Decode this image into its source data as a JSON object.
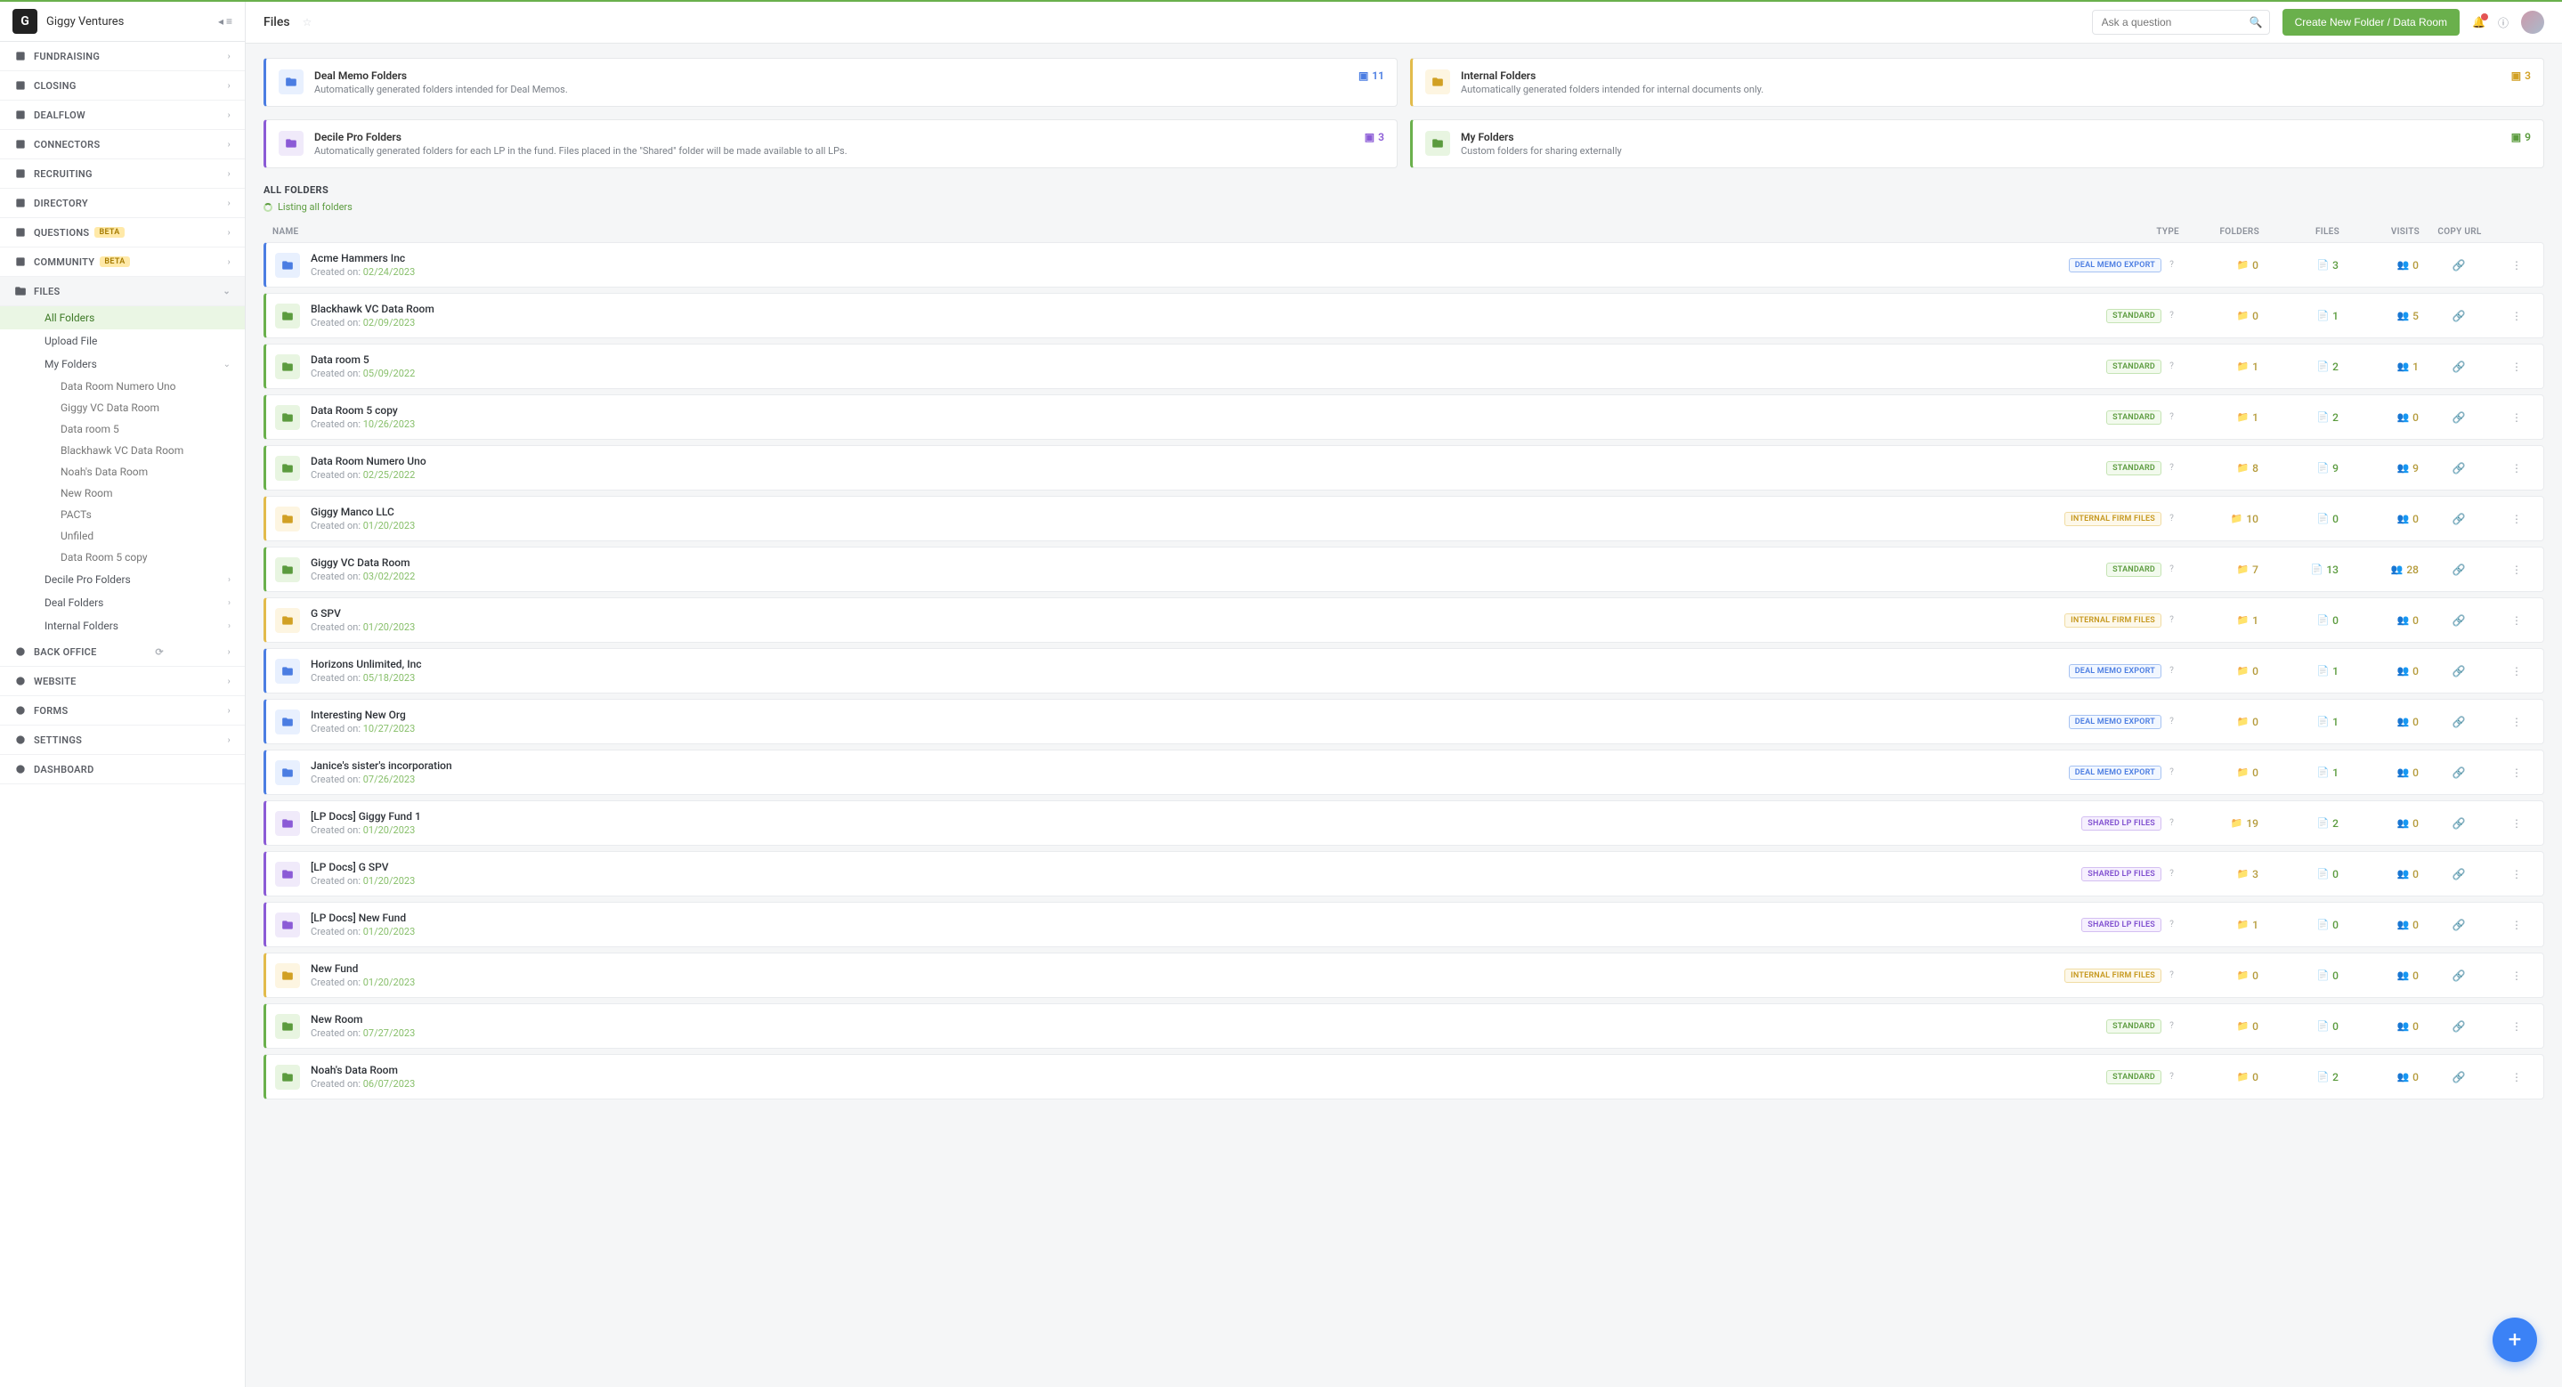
{
  "header": {
    "org_name": "Giggy Ventures",
    "page_title": "Files",
    "create_label": "Create New Folder / Data Room",
    "search_placeholder": "Ask a question"
  },
  "sidebar": {
    "items": [
      {
        "label": "FUNDRAISING",
        "icon": "chart"
      },
      {
        "label": "CLOSING",
        "icon": "check"
      },
      {
        "label": "DEALFLOW",
        "icon": "flow"
      },
      {
        "label": "CONNECTORS",
        "icon": "link"
      },
      {
        "label": "RECRUITING",
        "icon": "users"
      },
      {
        "label": "DIRECTORY",
        "icon": "book"
      },
      {
        "label": "QUESTIONS",
        "icon": "q",
        "badge": "BETA"
      },
      {
        "label": "COMMUNITY",
        "icon": "people",
        "badge": "BETA"
      }
    ],
    "files_label": "FILES",
    "files_children": [
      {
        "label": "All Folders",
        "active": true
      },
      {
        "label": "Upload File"
      },
      {
        "label": "My Folders",
        "expand": true,
        "children": [
          {
            "label": "Data Room Numero Uno"
          },
          {
            "label": "Giggy VC Data Room"
          },
          {
            "label": "Data room 5"
          },
          {
            "label": "Blackhawk VC Data Room"
          },
          {
            "label": "Noah's Data Room"
          },
          {
            "label": "New Room"
          },
          {
            "label": "PACTs"
          },
          {
            "label": "Unfiled"
          },
          {
            "label": "Data Room 5 copy"
          }
        ]
      },
      {
        "label": "Decile Pro Folders",
        "chev": true
      },
      {
        "label": "Deal Folders",
        "chev": true
      },
      {
        "label": "Internal Folders",
        "chev": true
      }
    ],
    "bottom": [
      {
        "label": "BACK OFFICE",
        "sync": true
      },
      {
        "label": "WEBSITE"
      },
      {
        "label": "FORMS"
      },
      {
        "label": "SETTINGS"
      },
      {
        "label": "DASHBOARD",
        "nochev": true
      }
    ]
  },
  "cards": [
    {
      "cls": "blue",
      "title": "Deal Memo Folders",
      "sub": "Automatically generated folders intended for Deal Memos.",
      "count": 11
    },
    {
      "cls": "yellow",
      "title": "Internal Folders",
      "sub": "Automatically generated folders intended for internal documents only.",
      "count": 3
    },
    {
      "cls": "purple",
      "title": "Decile Pro Folders",
      "sub": "Automatically generated folders for each LP in the fund. Files placed in the \"Shared\" folder will be made available to all LPs.",
      "count": 3
    },
    {
      "cls": "green",
      "title": "My Folders",
      "sub": "Custom folders for sharing externally",
      "count": 9
    }
  ],
  "section": {
    "title": "ALL FOLDERS",
    "listing": "Listing all folders"
  },
  "columns": {
    "name": "NAME",
    "type": "TYPE",
    "folders": "FOLDERS",
    "files": "FILES",
    "visits": "VISITS",
    "copy": "COPY URL"
  },
  "created_prefix": "Created on:",
  "type_labels": {
    "dme": "DEAL MEMO EXPORT",
    "std": "STANDARD",
    "int": "INTERNAL FIRM FILES",
    "shlp": "SHARED LP FILES"
  },
  "rows": [
    {
      "cls": "blue",
      "name": "Acme Hammers Inc",
      "date": "02/24/2023",
      "type": "dme",
      "folders": 0,
      "files": 3,
      "visits": 0
    },
    {
      "cls": "green",
      "name": "Blackhawk VC Data Room",
      "date": "02/09/2023",
      "type": "std",
      "folders": 0,
      "files": 1,
      "visits": 5
    },
    {
      "cls": "green",
      "name": "Data room 5",
      "date": "05/09/2022",
      "type": "std",
      "folders": 1,
      "files": 2,
      "visits": 1
    },
    {
      "cls": "green",
      "name": "Data Room 5 copy",
      "date": "10/26/2023",
      "type": "std",
      "folders": 1,
      "files": 2,
      "visits": 0
    },
    {
      "cls": "green",
      "name": "Data Room Numero Uno",
      "date": "02/25/2022",
      "type": "std",
      "folders": 8,
      "files": 9,
      "visits": 9
    },
    {
      "cls": "yellow",
      "name": "Giggy Manco LLC",
      "date": "01/20/2023",
      "type": "int",
      "folders": 10,
      "files": 0,
      "visits": 0
    },
    {
      "cls": "green",
      "name": "Giggy VC Data Room",
      "date": "03/02/2022",
      "type": "std",
      "folders": 7,
      "files": 13,
      "visits": 28
    },
    {
      "cls": "yellow",
      "name": "G SPV",
      "date": "01/20/2023",
      "type": "int",
      "folders": 1,
      "files": 0,
      "visits": 0
    },
    {
      "cls": "blue",
      "name": "Horizons Unlimited, Inc",
      "date": "05/18/2023",
      "type": "dme",
      "folders": 0,
      "files": 1,
      "visits": 0
    },
    {
      "cls": "blue",
      "name": "Interesting New Org",
      "date": "10/27/2023",
      "type": "dme",
      "folders": 0,
      "files": 1,
      "visits": 0
    },
    {
      "cls": "blue",
      "name": "Janice's sister's incorporation",
      "date": "07/26/2023",
      "type": "dme",
      "folders": 0,
      "files": 1,
      "visits": 0
    },
    {
      "cls": "purple",
      "name": "[LP Docs] Giggy Fund 1",
      "date": "01/20/2023",
      "type": "shlp",
      "folders": 19,
      "files": 2,
      "visits": 0
    },
    {
      "cls": "purple",
      "name": "[LP Docs] G SPV",
      "date": "01/20/2023",
      "type": "shlp",
      "folders": 3,
      "files": 0,
      "visits": 0
    },
    {
      "cls": "purple",
      "name": "[LP Docs] New Fund",
      "date": "01/20/2023",
      "type": "shlp",
      "folders": 1,
      "files": 0,
      "visits": 0
    },
    {
      "cls": "yellow",
      "name": "New Fund",
      "date": "01/20/2023",
      "type": "int",
      "folders": 0,
      "files": 0,
      "visits": 0
    },
    {
      "cls": "green",
      "name": "New Room",
      "date": "07/27/2023",
      "type": "std",
      "folders": 0,
      "files": 0,
      "visits": 0
    },
    {
      "cls": "green",
      "name": "Noah's Data Room",
      "date": "06/07/2023",
      "type": "std",
      "folders": 0,
      "files": 2,
      "visits": 0
    }
  ]
}
